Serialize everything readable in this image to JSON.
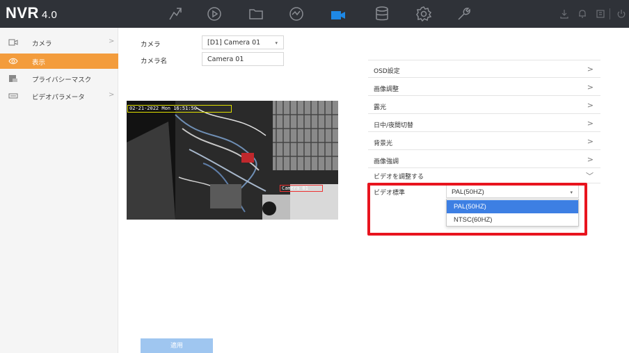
{
  "app": {
    "logo": "NVR",
    "version": "4.0"
  },
  "topnav": [
    {
      "icon": "live-view-icon"
    },
    {
      "icon": "playback-icon"
    },
    {
      "icon": "file-management-icon"
    },
    {
      "icon": "smart-analysis-icon"
    },
    {
      "icon": "camera-icon"
    },
    {
      "icon": "storage-icon"
    },
    {
      "icon": "system-settings-icon"
    },
    {
      "icon": "maintenance-icon"
    }
  ],
  "sidebar": {
    "items": [
      {
        "label": "カメラ",
        "icon": "camera-icon",
        "chevron": ">"
      },
      {
        "label": "表示",
        "icon": "eye-icon",
        "active": true
      },
      {
        "label": "プライバシーマスク",
        "icon": "privacy-mask-icon"
      },
      {
        "label": "ビデオパラメータ",
        "icon": "video-parameter-icon",
        "chevron": ">"
      }
    ]
  },
  "form": {
    "camera_label": "カメラ",
    "camera_value": "[D1] Camera 01",
    "camera_name_label": "カメラ名",
    "camera_name_value": "Camera 01"
  },
  "video": {
    "osd_time": "02-21-2022 Mon 16:51:50",
    "osd_name": "Camera 01"
  },
  "accordion": [
    {
      "label": "OSD設定",
      "chevron": ">"
    },
    {
      "label": "画像調整",
      "chevron": ">"
    },
    {
      "label": "露光",
      "chevron": ">"
    },
    {
      "label": "日中/夜間切替",
      "chevron": ">"
    },
    {
      "label": "背景光",
      "chevron": ">"
    },
    {
      "label": "画像強調",
      "chevron": ">"
    },
    {
      "label": "ビデオを調整する",
      "chevron": "﹀"
    }
  ],
  "video_standard": {
    "label": "ビデオ標準",
    "selected": "PAL(50HZ)",
    "options": [
      "PAL(50HZ)",
      "NTSC(60HZ)"
    ]
  },
  "apply_button": "適用",
  "colors": {
    "topbar": "#2f3238",
    "accent": "#f39c3c",
    "active_nav": "#1e88e5",
    "selection": "#3d7fe3",
    "highlight": "#e8141e"
  }
}
